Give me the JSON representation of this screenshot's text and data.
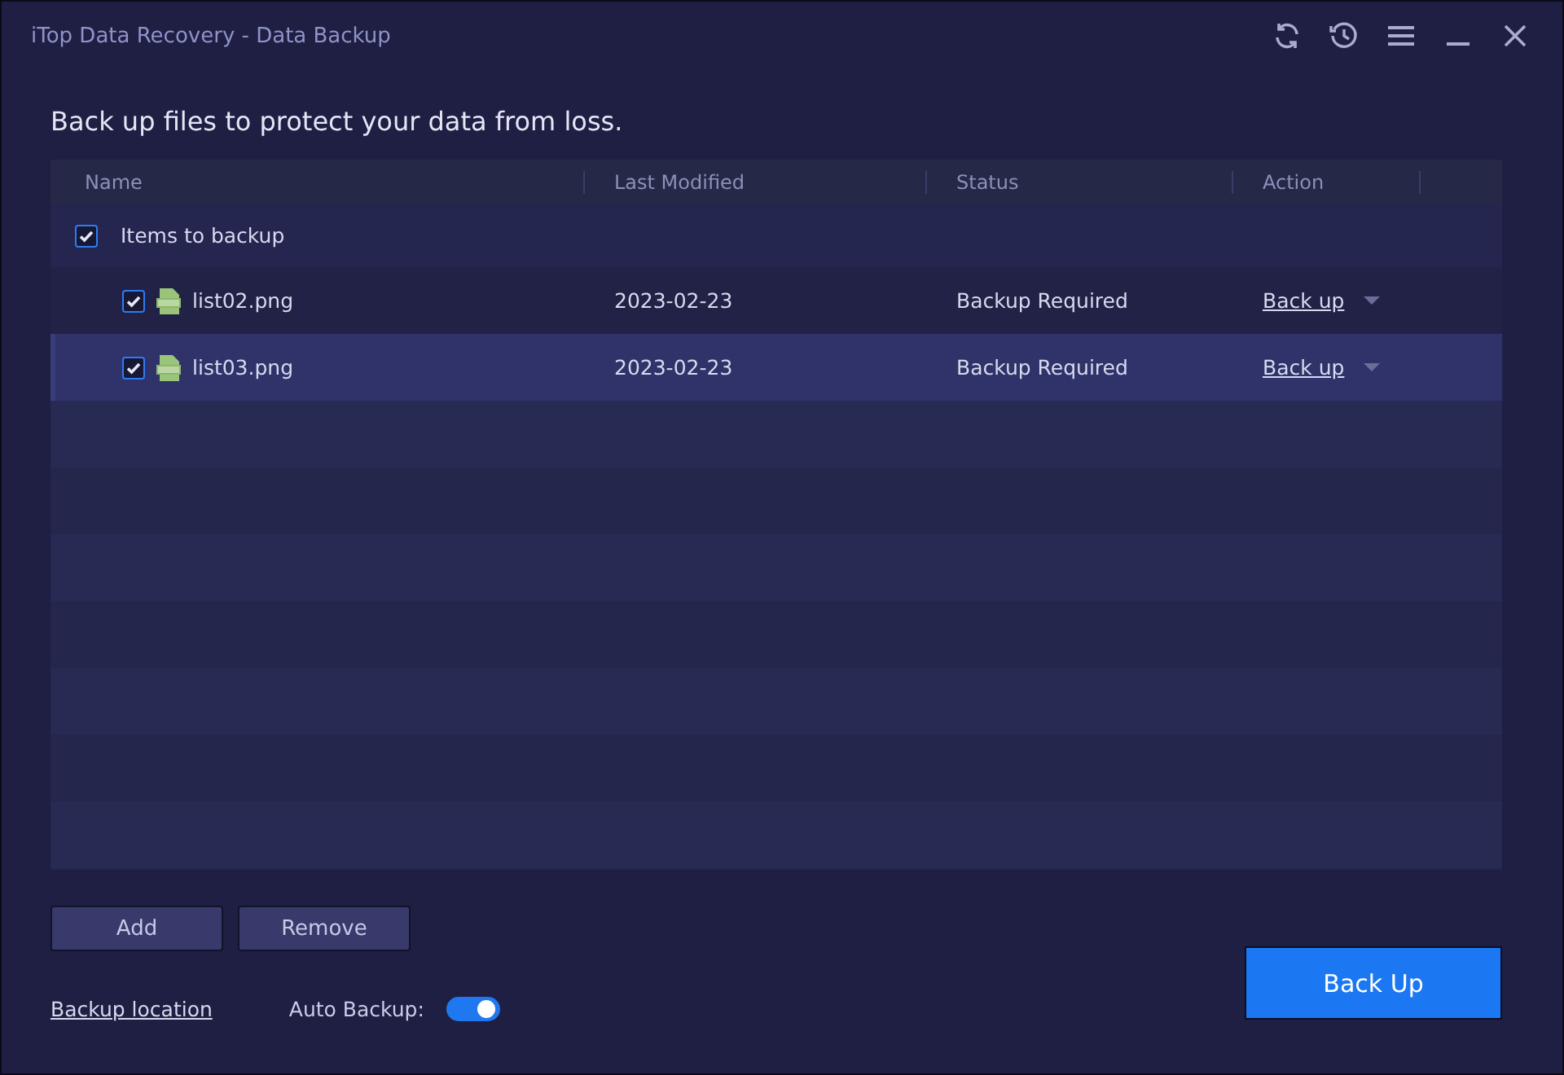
{
  "window": {
    "title": "iTop Data Recovery - Data Backup"
  },
  "heading": "Back up files to protect your data from loss.",
  "table": {
    "columns": [
      "Name",
      "Last Modified",
      "Status",
      "Action"
    ],
    "group": {
      "label": "Items to backup",
      "checked": true
    },
    "rows": [
      {
        "name": "list02.png",
        "modified": "2023-02-23",
        "status": "Backup Required",
        "action": "Back up",
        "checked": true,
        "selected": false
      },
      {
        "name": "list03.png",
        "modified": "2023-02-23",
        "status": "Backup Required",
        "action": "Back up",
        "checked": true,
        "selected": true
      }
    ]
  },
  "buttons": [
    "Add",
    "Remove"
  ],
  "backup_location": "Backup location",
  "auto_backup": {
    "label": "Auto Backup:",
    "on": true
  },
  "primary_button": "Back Up"
}
